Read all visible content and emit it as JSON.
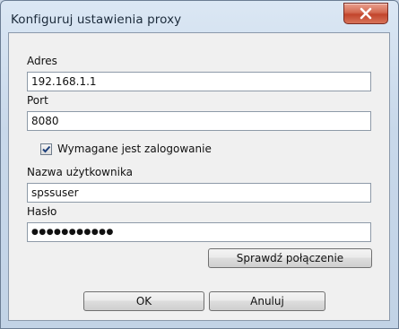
{
  "window": {
    "title": "Konfiguruj ustawienia proxy"
  },
  "form": {
    "address_label": "Adres",
    "address_value": "192.168.1.1",
    "port_label": "Port",
    "port_value": "8080",
    "login_required_label": "Wymagane jest zalogowanie",
    "login_required_checked": true,
    "username_label": "Nazwa użytkownika",
    "username_value": "spssuser",
    "password_label": "Hasło",
    "password_value": "●●●●●●●●●●●"
  },
  "buttons": {
    "test_connection": "Sprawdź połączenie",
    "ok": "OK",
    "cancel": "Anuluj"
  },
  "colors": {
    "close_button": "#c2452c",
    "dialog_bg": "#f0f0f0",
    "frame_bg": "#c8d8ea"
  }
}
